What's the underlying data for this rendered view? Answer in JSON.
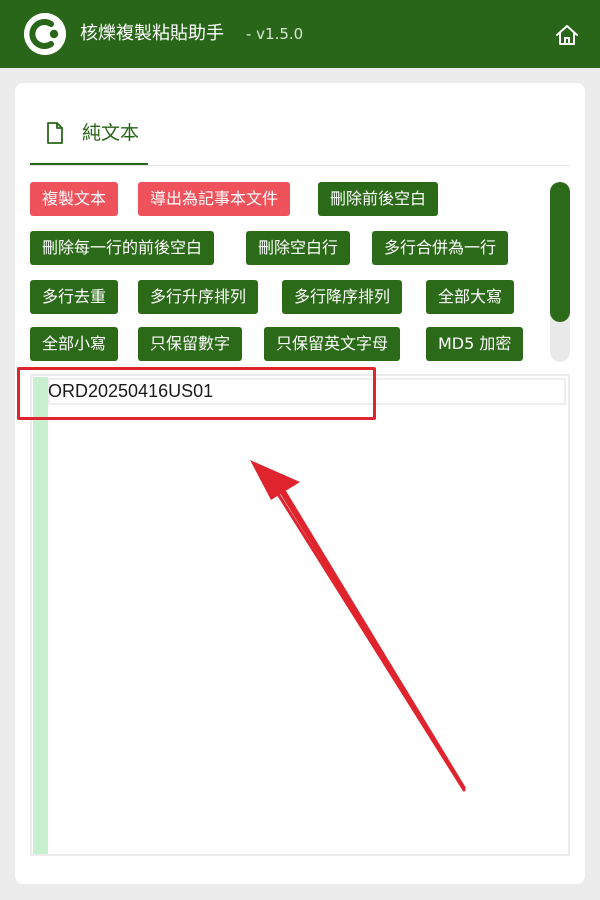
{
  "app": {
    "title": "核爍複製粘貼助手",
    "version": "- v1.5.0"
  },
  "tab": {
    "label": "純文本",
    "icon": "file-icon"
  },
  "buttons": [
    {
      "label": "複製文本",
      "color": "#f0525c"
    },
    {
      "label": "導出為記事本文件",
      "color": "#f0525c"
    },
    {
      "label": "刪除前後空白",
      "color": "#2b6a18"
    },
    {
      "label": "刪除每一行的前後空白",
      "color": "#2b6a18"
    },
    {
      "label": "刪除空白行",
      "color": "#2b6a18"
    },
    {
      "label": "多行合併為一行",
      "color": "#2b6a18"
    },
    {
      "label": "多行去重",
      "color": "#2b6a18"
    },
    {
      "label": "多行升序排列",
      "color": "#2b6a18"
    },
    {
      "label": "多行降序排列",
      "color": "#2b6a18"
    },
    {
      "label": "全部大寫",
      "color": "#2b6a18"
    },
    {
      "label": "全部小寫",
      "color": "#2b6a18"
    },
    {
      "label": "只保留數字",
      "color": "#2b6a18"
    },
    {
      "label": "只保留英文字母",
      "color": "#2b6a18"
    },
    {
      "label": "MD5 加密",
      "color": "#2b6a18"
    }
  ],
  "editor": {
    "lines": [
      "ORD20250416US01"
    ]
  },
  "colors": {
    "brand_green": "#2a6619",
    "annotation_red": "#e0242e"
  }
}
